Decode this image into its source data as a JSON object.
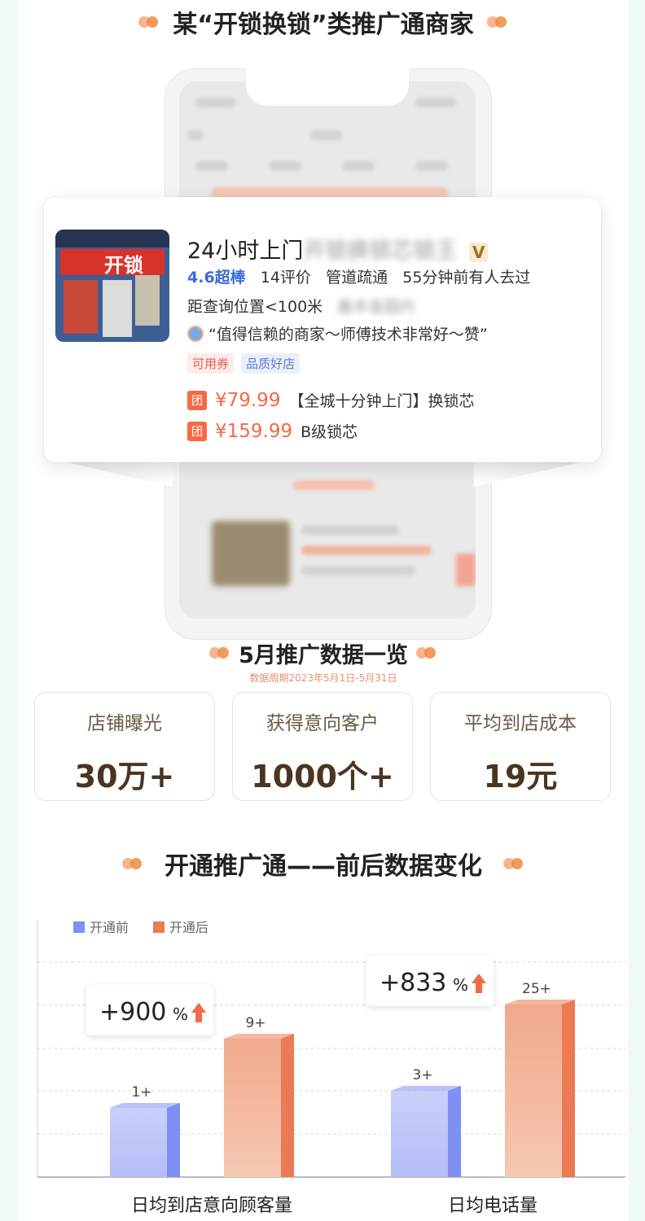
{
  "header_title": "某“开锁换锁”类推广通商家",
  "merchant": {
    "name": "24小时上门",
    "name_blurred": "开锁换锁芯锁王",
    "v_badge": "V",
    "rating": "4.6超棒",
    "reviews": "14评价",
    "category": "管道疏通",
    "recent_visit": "55分钟前有人去过",
    "distance": "距查询位置<100米",
    "area_blurred": "鑫丰金园内",
    "review_quote": "“值得信赖的商家～师傅技术非常好～赞”",
    "tags": [
      "可用券",
      "品质好店"
    ],
    "photo_sign": "开锁",
    "deals": [
      {
        "badge": "团",
        "price": "¥79.99",
        "desc": "【全城十分钟上门】换锁芯"
      },
      {
        "badge": "团",
        "price": "¥159.99",
        "desc": "B级锁芯"
      }
    ]
  },
  "summary": {
    "title": "5月推广数据一览",
    "subtitle": "数据周期2023年5月1日-5月31日",
    "stats": [
      {
        "label": "店铺曝光",
        "value": "30万+"
      },
      {
        "label": "获得意向客户",
        "value": "1000个+"
      },
      {
        "label": "平均到店成本",
        "value": "19元"
      }
    ]
  },
  "change_title": "开通推广通——前后数据变化",
  "colors": {
    "before": "#7f8ff4",
    "after": "#ec7a55",
    "accent": "#f46a46"
  },
  "chart_data": {
    "type": "bar",
    "categories": [
      "日均到店意向顾客量",
      "日均电话量"
    ],
    "series": [
      {
        "name": "开通前",
        "values": [
          1,
          3
        ],
        "labels": [
          "1+",
          "3+"
        ]
      },
      {
        "name": "开通后",
        "values": [
          9,
          25
        ],
        "labels": [
          "9+",
          "25+"
        ]
      }
    ],
    "increase_labels": [
      "+900%",
      "+833%"
    ],
    "grid": true,
    "legend": "top-left"
  }
}
